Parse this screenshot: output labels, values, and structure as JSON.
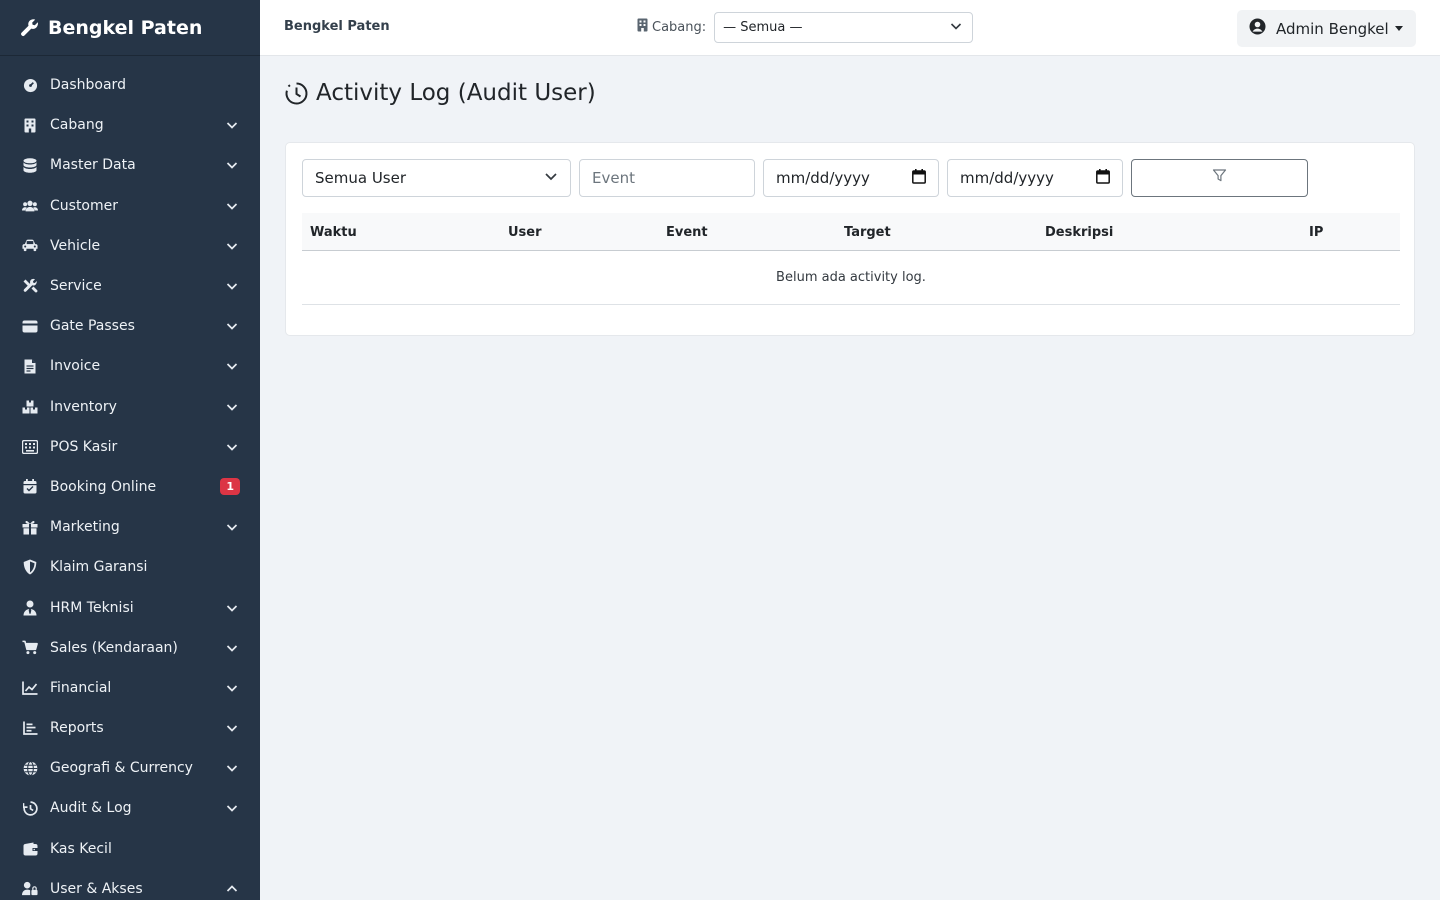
{
  "app": {
    "brand": "Bengkel Paten",
    "top_brand": "Bengkel Paten"
  },
  "sidebar": {
    "items": [
      {
        "label": "Dashboard",
        "icon": "dashboard-icon",
        "has_chevron": false
      },
      {
        "label": "Cabang",
        "icon": "building-icon",
        "has_chevron": true
      },
      {
        "label": "Master Data",
        "icon": "database-icon",
        "has_chevron": true
      },
      {
        "label": "Customer",
        "icon": "users-icon",
        "has_chevron": true
      },
      {
        "label": "Vehicle",
        "icon": "car-icon",
        "has_chevron": true
      },
      {
        "label": "Service",
        "icon": "tools-icon",
        "has_chevron": true
      },
      {
        "label": "Gate Passes",
        "icon": "ticket-icon",
        "has_chevron": true
      },
      {
        "label": "Invoice",
        "icon": "invoice-icon",
        "has_chevron": true
      },
      {
        "label": "Inventory",
        "icon": "boxes-icon",
        "has_chevron": true
      },
      {
        "label": "POS Kasir",
        "icon": "keyboard-icon",
        "has_chevron": true
      },
      {
        "label": "Booking Online",
        "icon": "calendar-icon",
        "has_chevron": false,
        "badge": "1"
      },
      {
        "label": "Marketing",
        "icon": "gift-icon",
        "has_chevron": true
      },
      {
        "label": "Klaim Garansi",
        "icon": "shield-icon",
        "has_chevron": false
      },
      {
        "label": "HRM Teknisi",
        "icon": "user-tie-icon",
        "has_chevron": true
      },
      {
        "label": "Sales (Kendaraan)",
        "icon": "cart-icon",
        "has_chevron": true
      },
      {
        "label": "Financial",
        "icon": "line-chart-icon",
        "has_chevron": true
      },
      {
        "label": "Reports",
        "icon": "bar-list-icon",
        "has_chevron": true
      },
      {
        "label": "Geografi & Currency",
        "icon": "globe-icon",
        "has_chevron": true
      },
      {
        "label": "Audit & Log",
        "icon": "history-icon",
        "has_chevron": true
      },
      {
        "label": "Kas Kecil",
        "icon": "wallet-icon",
        "has_chevron": false
      },
      {
        "label": "User & Akses",
        "icon": "user-lock-icon",
        "has_chevron": true,
        "expanded": true
      }
    ]
  },
  "header": {
    "branch_label": "Cabang:",
    "branch_value": "— Semua —",
    "user_name": "Admin Bengkel"
  },
  "page": {
    "title": "Activity Log (Audit User)",
    "filters": {
      "user_select": "Semua User",
      "event_placeholder": "Event",
      "date_from": "mm/dd/yyyy",
      "date_to": "mm/dd/yyyy"
    },
    "table": {
      "columns": [
        "Waktu",
        "User",
        "Event",
        "Target",
        "Deskripsi",
        "IP"
      ],
      "empty_message": "Belum ada activity log."
    }
  },
  "colors": {
    "sidebar_bg": "#263547",
    "badge": "#dc3545",
    "page_bg": "#f0f3f7"
  }
}
